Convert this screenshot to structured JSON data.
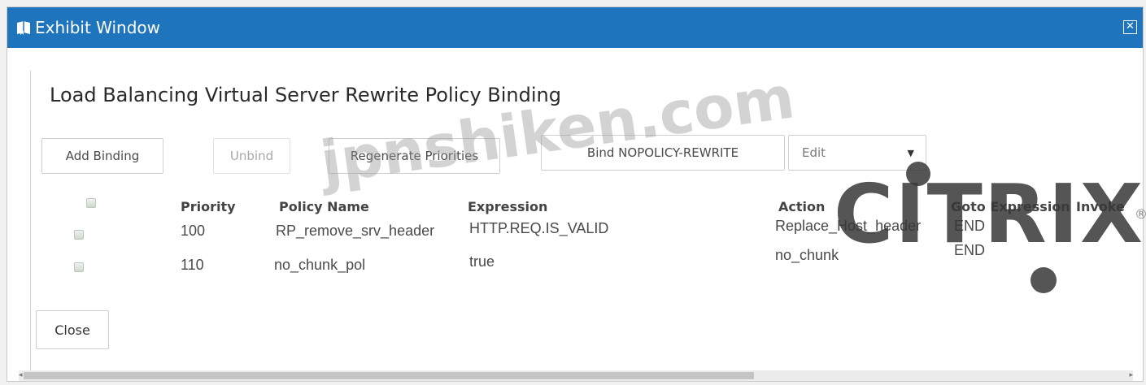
{
  "window": {
    "title": "Exhibit Window",
    "title_icon": "exhibit-book-icon",
    "close_icon": "close-box-icon",
    "close_glyph": "✕",
    "titlebar_color": "#1e74bd"
  },
  "dialog": {
    "heading": "Load Balancing Virtual Server Rewrite Policy Binding"
  },
  "toolbar": {
    "add_binding": "Add Binding",
    "unbind": "Unbind",
    "regenerate": "Regenerate Priorities",
    "bind_nopolicy": "Bind NOPOLICY-REWRITE",
    "edit": "Edit",
    "edit_caret": "▼"
  },
  "table": {
    "columns": [
      "Priority",
      "Policy Name",
      "Expression",
      "Action",
      "Goto Expression",
      "Invoke"
    ],
    "rows": [
      {
        "priority": "100",
        "policy_name": "RP_remove_srv_header",
        "expression": "HTTP.REQ.IS_VALID",
        "action": "Replace_Host_header",
        "goto": "END"
      },
      {
        "priority": "110",
        "policy_name": "no_chunk_pol",
        "expression": "true",
        "action": "no_chunk",
        "goto": "END"
      }
    ]
  },
  "footer": {
    "close": "Close"
  },
  "overlays": {
    "watermark": "jpnshiken.com",
    "logo": "CITRIX",
    "logo_mark": "®"
  }
}
